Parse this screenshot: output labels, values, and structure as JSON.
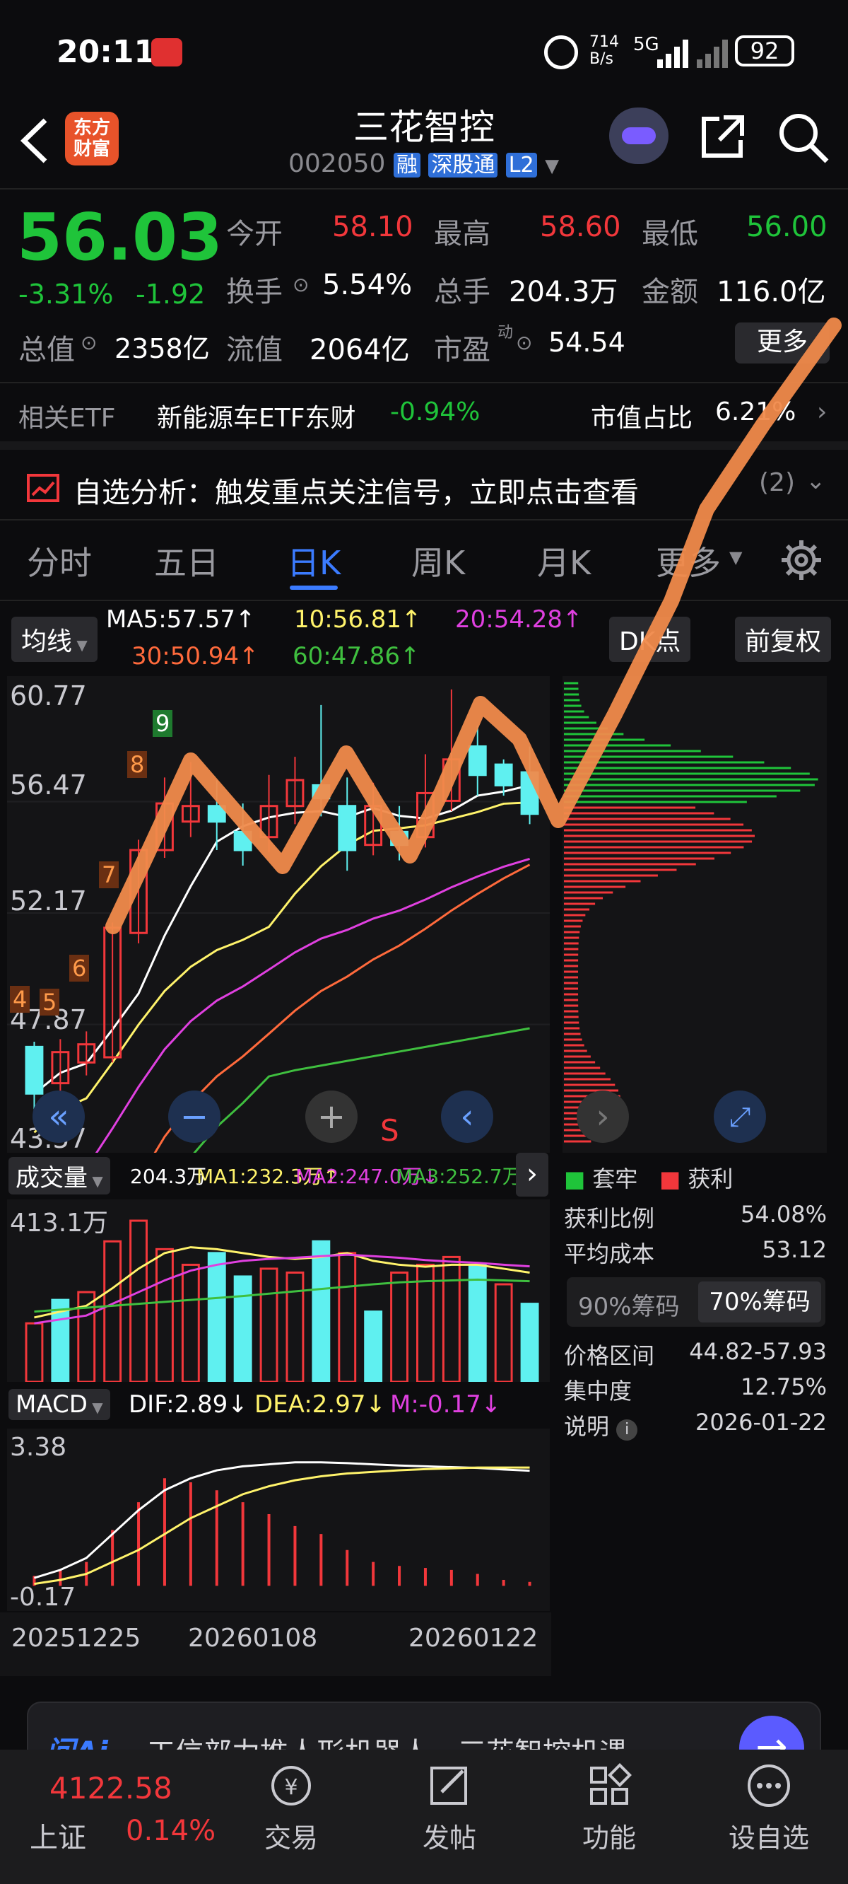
{
  "status": {
    "time": "20:11",
    "net_speed": "714\nB/s",
    "signal": "5G",
    "battery": "92"
  },
  "header": {
    "brand": "东方\n财富",
    "title": "三花智控",
    "code": "002050",
    "badges": [
      "融",
      "深股通",
      "L2"
    ]
  },
  "quote": {
    "price": "56.03",
    "change_pct": "-3.31%",
    "change": "-1.92",
    "fields": [
      {
        "label": "今开",
        "value": "58.10"
      },
      {
        "label": "最高",
        "value": "58.60"
      },
      {
        "label": "最低",
        "value": "56.00"
      },
      {
        "label": "换手",
        "value": "5.54%"
      },
      {
        "label": "总手",
        "value": "204.3万"
      },
      {
        "label": "金额",
        "value": "116.0亿"
      },
      {
        "label": "总值",
        "value": "2358亿"
      },
      {
        "label": "流值",
        "value": "2064亿"
      },
      {
        "label": "市盈",
        "value": "54.54",
        "sup": "动"
      }
    ],
    "more": "更多"
  },
  "etf": {
    "label": "相关ETF",
    "name": "新能源车ETF东财",
    "change": "-0.94%",
    "share_label": "市值占比",
    "share": "6.21%"
  },
  "analysis": {
    "text": "自选分析：触发重点关注信号，立即点击查看",
    "count": "(2)"
  },
  "tabs": [
    "分时",
    "五日",
    "日K",
    "周K",
    "月K",
    "更多"
  ],
  "chart_controls": {
    "ma_label": "均线",
    "dk": "DK点",
    "adjust": "前复权"
  },
  "ma": {
    "ma5": "MA5:57.57↑",
    "ma10": "10:56.81↑",
    "ma20": "20:54.28↑",
    "ma30": "30:50.94↑",
    "ma60": "60:47.86↑"
  },
  "price_axis": [
    "60.77",
    "56.47",
    "52.17",
    "47.87",
    "43.57"
  ],
  "signal_tags": [
    "4",
    "5",
    "6",
    "7",
    "8",
    "9"
  ],
  "sell_mark": "S",
  "volume": {
    "label": "成交量",
    "value": "204.3万",
    "ma1": "MA1:232.3万↑",
    "ma2": "MA2:247.0万↓",
    "ma3": "MA3:252.7万↑",
    "axis_top": "413.1万"
  },
  "macd": {
    "label": "MACD",
    "dif": "DIF:2.89↓",
    "dea": "DEA:2.97↓",
    "m": "M:-0.17↓",
    "axis_top": "3.38",
    "axis_bottom": "-0.17"
  },
  "dates": [
    "20251225",
    "20260108",
    "20260122"
  ],
  "chips": {
    "legend_trapped": "套牢",
    "legend_profit": "获利",
    "rows": [
      {
        "label": "获利比例",
        "value": "54.08%"
      },
      {
        "label": "平均成本",
        "value": "53.12"
      }
    ],
    "tab_90": "90%筹码",
    "tab_70": "70%筹码",
    "rows2": [
      {
        "label": "价格区间",
        "value": "44.82-57.93"
      },
      {
        "label": "集中度",
        "value": "12.75%"
      },
      {
        "label": "说明",
        "value": "2026-01-22"
      }
    ]
  },
  "ai_banner": {
    "logo": "问Ai",
    "text": "工信部力推人形机器人，三花智控机遇"
  },
  "bottom_nav": {
    "index_value": "4122.58",
    "index_name": "上证",
    "index_change": "0.14%",
    "items": [
      "交易",
      "发帖",
      "功能",
      "设自选"
    ]
  },
  "colors": {
    "up": "#f2373b",
    "down": "#1fc43a",
    "accent": "#3b7bff",
    "ma5": "#ffffff",
    "ma10": "#fff36b",
    "ma20": "#e040e0",
    "ma30": "#ff6a3c",
    "ma60": "#3fbf3f",
    "annotation": "#f08a4b"
  },
  "chart_data": {
    "type": "candlestick",
    "price_range": [
      43.57,
      60.77
    ],
    "candles": [
      {
        "o": 47.0,
        "c": 45.2,
        "h": 47.2,
        "l": 44.2
      },
      {
        "o": 45.6,
        "c": 46.8,
        "h": 47.3,
        "l": 45.0
      },
      {
        "o": 46.4,
        "c": 47.1,
        "h": 47.6,
        "l": 45.9
      },
      {
        "o": 46.6,
        "c": 51.6,
        "h": 51.8,
        "l": 46.4
      },
      {
        "o": 51.4,
        "c": 54.6,
        "h": 55.0,
        "l": 51.0
      },
      {
        "o": 54.6,
        "c": 56.4,
        "h": 57.4,
        "l": 54.3
      },
      {
        "o": 55.7,
        "c": 56.3,
        "h": 58.0,
        "l": 55.1
      },
      {
        "o": 56.3,
        "c": 55.7,
        "h": 57.3,
        "l": 54.6
      },
      {
        "o": 55.3,
        "c": 54.6,
        "h": 56.4,
        "l": 54.0
      },
      {
        "o": 55.1,
        "c": 56.3,
        "h": 57.5,
        "l": 54.5
      },
      {
        "o": 56.3,
        "c": 57.3,
        "h": 58.2,
        "l": 55.6
      },
      {
        "o": 57.1,
        "c": 56.6,
        "h": 60.2,
        "l": 55.9
      },
      {
        "o": 56.3,
        "c": 54.6,
        "h": 57.4,
        "l": 53.8
      },
      {
        "o": 54.8,
        "c": 56.3,
        "h": 57.2,
        "l": 54.4
      },
      {
        "o": 55.3,
        "c": 54.8,
        "h": 56.3,
        "l": 54.2
      },
      {
        "o": 55.1,
        "c": 56.8,
        "h": 58.3,
        "l": 54.7
      },
      {
        "o": 56.5,
        "c": 58.1,
        "h": 60.8,
        "l": 56.1
      },
      {
        "o": 58.6,
        "c": 57.5,
        "h": 59.4,
        "l": 56.7
      },
      {
        "o": 57.9,
        "c": 57.1,
        "h": 58.1,
        "l": 56.7
      },
      {
        "o": 57.6,
        "c": 56.0,
        "h": 58.6,
        "l": 55.6
      }
    ],
    "volume_range": [
      0,
      413.1
    ],
    "volumes": [
      {
        "v": 150,
        "up": true
      },
      {
        "v": 210,
        "up": false
      },
      {
        "v": 230,
        "up": true
      },
      {
        "v": 360,
        "up": true
      },
      {
        "v": 413,
        "up": true
      },
      {
        "v": 340,
        "up": true
      },
      {
        "v": 300,
        "up": true
      },
      {
        "v": 330,
        "up": false
      },
      {
        "v": 270,
        "up": false
      },
      {
        "v": 290,
        "up": true
      },
      {
        "v": 280,
        "up": true
      },
      {
        "v": 360,
        "up": false
      },
      {
        "v": 330,
        "up": true
      },
      {
        "v": 180,
        "up": false
      },
      {
        "v": 280,
        "up": true
      },
      {
        "v": 300,
        "up": true
      },
      {
        "v": 320,
        "up": true
      },
      {
        "v": 300,
        "up": false
      },
      {
        "v": 250,
        "up": true
      },
      {
        "v": 200,
        "up": false
      }
    ],
    "macd_range": [
      -0.17,
      3.38
    ],
    "macd_bars": [
      0.25,
      0.4,
      0.6,
      1.4,
      2.1,
      2.7,
      2.6,
      2.4,
      2.1,
      1.8,
      1.5,
      1.3,
      0.9,
      0.6,
      0.5,
      0.45,
      0.4,
      0.3,
      0.15,
      0.1
    ]
  }
}
